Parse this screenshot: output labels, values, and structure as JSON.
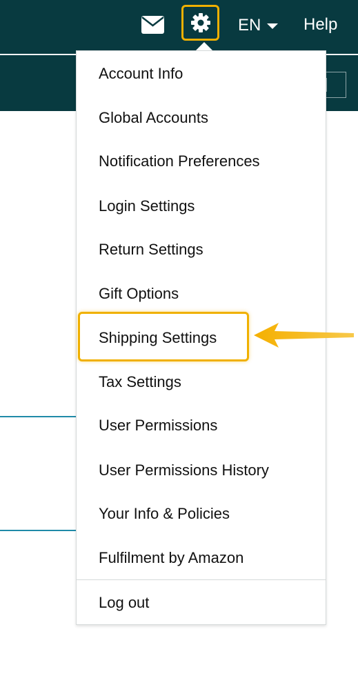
{
  "header": {
    "language": "EN",
    "help_label": "Help",
    "icons": {
      "mail": "mail-icon",
      "settings": "gear-icon",
      "language_caret": "chevron-down-icon"
    }
  },
  "settings_menu": {
    "items": [
      {
        "label": "Account Info"
      },
      {
        "label": "Global Accounts"
      },
      {
        "label": "Notification Preferences"
      },
      {
        "label": "Login Settings"
      },
      {
        "label": "Return Settings"
      },
      {
        "label": "Gift Options"
      },
      {
        "label": "Shipping Settings",
        "highlighted": true
      },
      {
        "label": "Tax Settings"
      },
      {
        "label": "User Permissions"
      },
      {
        "label": "User Permissions History"
      },
      {
        "label": "Your Info & Policies"
      },
      {
        "label": "Fulfilment by Amazon"
      }
    ],
    "logout_label": "Log out"
  },
  "colors": {
    "header_bg": "#083a40",
    "highlight": "#f0b000",
    "menu_text": "#111111",
    "accent_line": "#1f8aa8"
  }
}
